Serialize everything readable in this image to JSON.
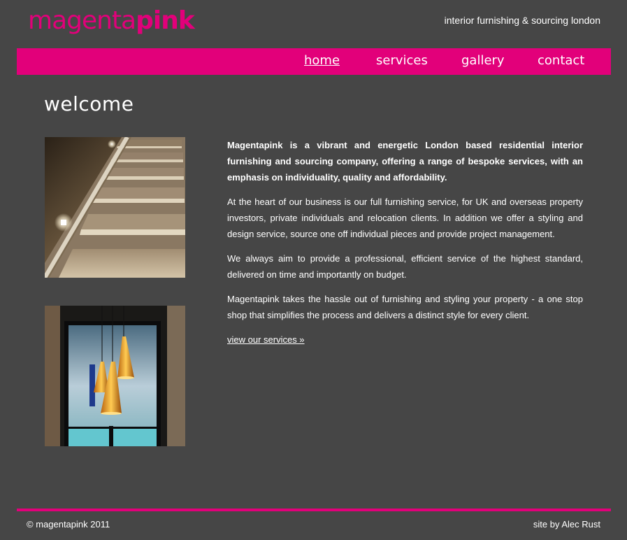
{
  "header": {
    "logo_light": "magenta",
    "logo_bold": "pink",
    "tagline": "interior furnishing & sourcing london"
  },
  "nav": {
    "items": [
      {
        "label": "home",
        "current": true
      },
      {
        "label": "services",
        "current": false
      },
      {
        "label": "gallery",
        "current": false
      },
      {
        "label": "contact",
        "current": false
      }
    ]
  },
  "main": {
    "heading": "welcome",
    "paragraphs": [
      "Magentapink is a vibrant and energetic London based residential interior furnishing and sourcing company, offering a range of bespoke services, with an emphasis on individuality, quality and affordability.",
      "At the heart of our business is our full furnishing service, for UK and overseas property investors, private individuals and relocation clients. In addition we offer a styling and design service, source one off individual pieces and provide project management.",
      "We always aim to provide a professional, efficient service of the highest standard, delivered on time and importantly on budget.",
      "Magentapink takes the hassle out of furnishing and styling your property - a one stop shop that simplifies the process and delivers a distinct style for every client."
    ],
    "more_link": "view our services »"
  },
  "footer": {
    "copyright": "© magentapink 2011",
    "credit": "site by Alec Rust"
  },
  "colors": {
    "brand": "#e2007a",
    "background": "#464646",
    "text": "#ffffff"
  }
}
